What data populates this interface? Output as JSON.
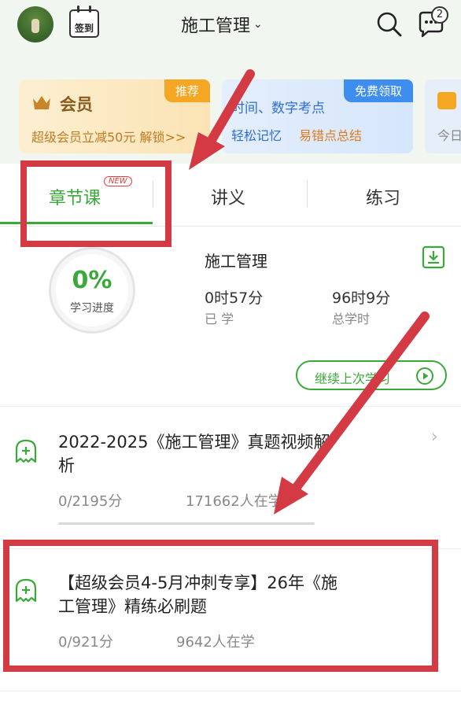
{
  "header": {
    "checkin_label": "签到",
    "title": "施工管理",
    "title_chevron": "⌄",
    "message_count": "2"
  },
  "promos": [
    {
      "tag": "推荐",
      "title": "会员",
      "desc": "超级会员立减50元 解锁>>"
    },
    {
      "tag": "免费领取",
      "title": "时间、数字考点",
      "sub1": "轻松记忆",
      "sub2": "易错点总结"
    },
    {
      "text": "今日"
    }
  ],
  "tabs": [
    {
      "label": "章节课",
      "badge": "NEW",
      "active": true
    },
    {
      "label": "讲义",
      "active": false
    },
    {
      "label": "练习",
      "active": false
    }
  ],
  "progress": {
    "percent": "0%",
    "label": "学习进度",
    "course": "施工管理",
    "studied_value": "0时57分",
    "studied_label": "已 学",
    "total_value": "96时9分",
    "total_label": "总学时",
    "continue_label": "继续上次学习"
  },
  "items": [
    {
      "title": "2022-2025《施工管理》真题视频解析",
      "score": "0/2195分",
      "learners": "171662人在学"
    },
    {
      "title": "【超级会员4-5月冲刺专享】26年《施工管理》精练必刷题",
      "score": "0/921分",
      "learners": "9642人在学"
    }
  ],
  "colors": {
    "accent": "#3aa93a",
    "annotation": "#d33a43",
    "promo_orange": "#f5a623",
    "promo_blue": "#3e8ef0"
  }
}
